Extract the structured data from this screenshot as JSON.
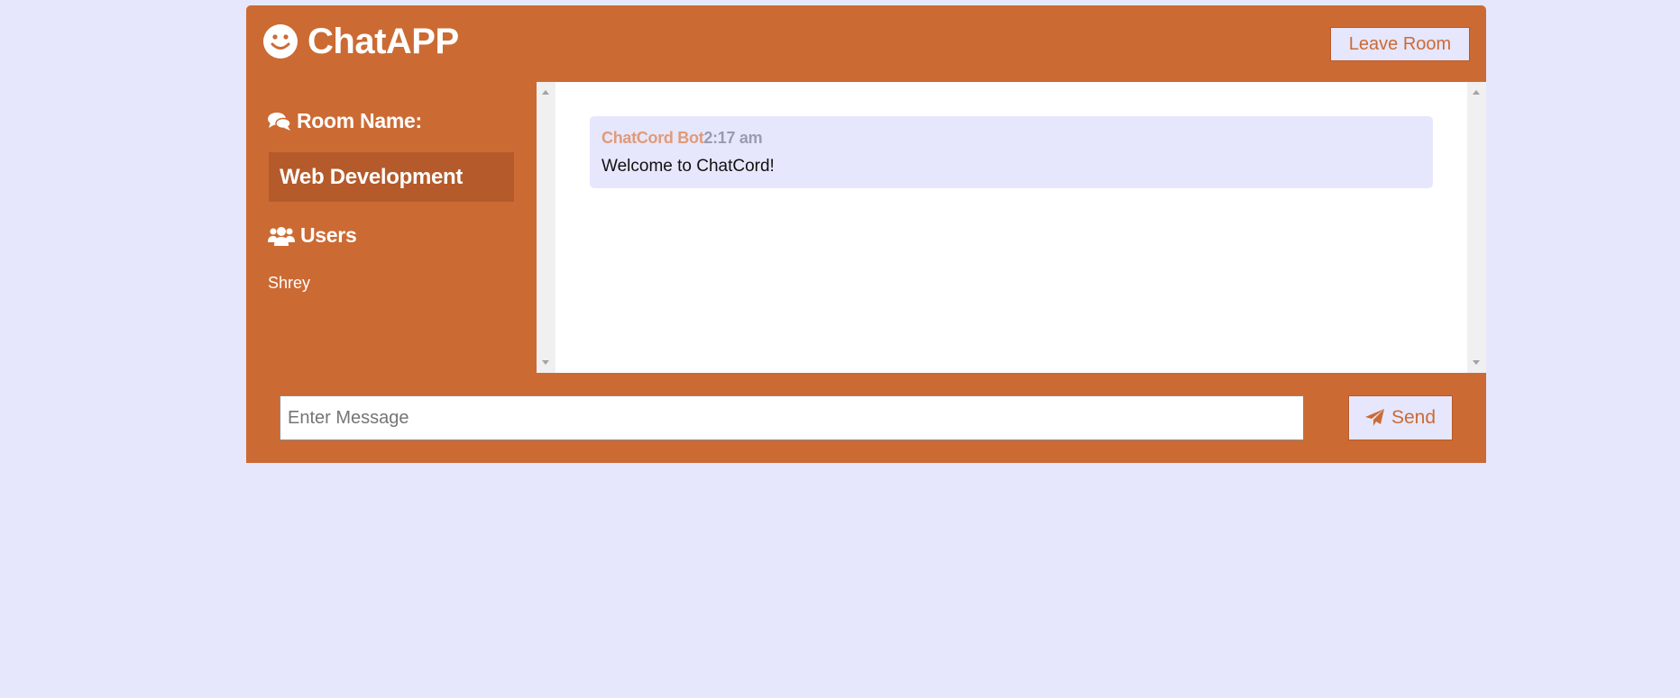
{
  "header": {
    "app_title": "ChatAPP",
    "brand_icon": "smile-icon",
    "leave_button": "Leave Room"
  },
  "sidebar": {
    "room_heading": "Room Name:",
    "room_icon": "comments-icon",
    "room_name": "Web Development",
    "users_heading": "Users",
    "users_icon": "users-icon",
    "users": [
      "Shrey"
    ]
  },
  "messages": [
    {
      "username": "ChatCord Bot",
      "time": "2:17 am",
      "text": "Welcome to ChatCord!"
    }
  ],
  "form": {
    "placeholder": "Enter Message",
    "value": "",
    "send_label": "Send",
    "send_icon": "paper-plane-icon"
  },
  "colors": {
    "primary": "#cc6a34",
    "primary_dark": "#b55a2a",
    "background": "#e6e7fd",
    "username": "#e19a78",
    "time": "#9a9bb0"
  }
}
